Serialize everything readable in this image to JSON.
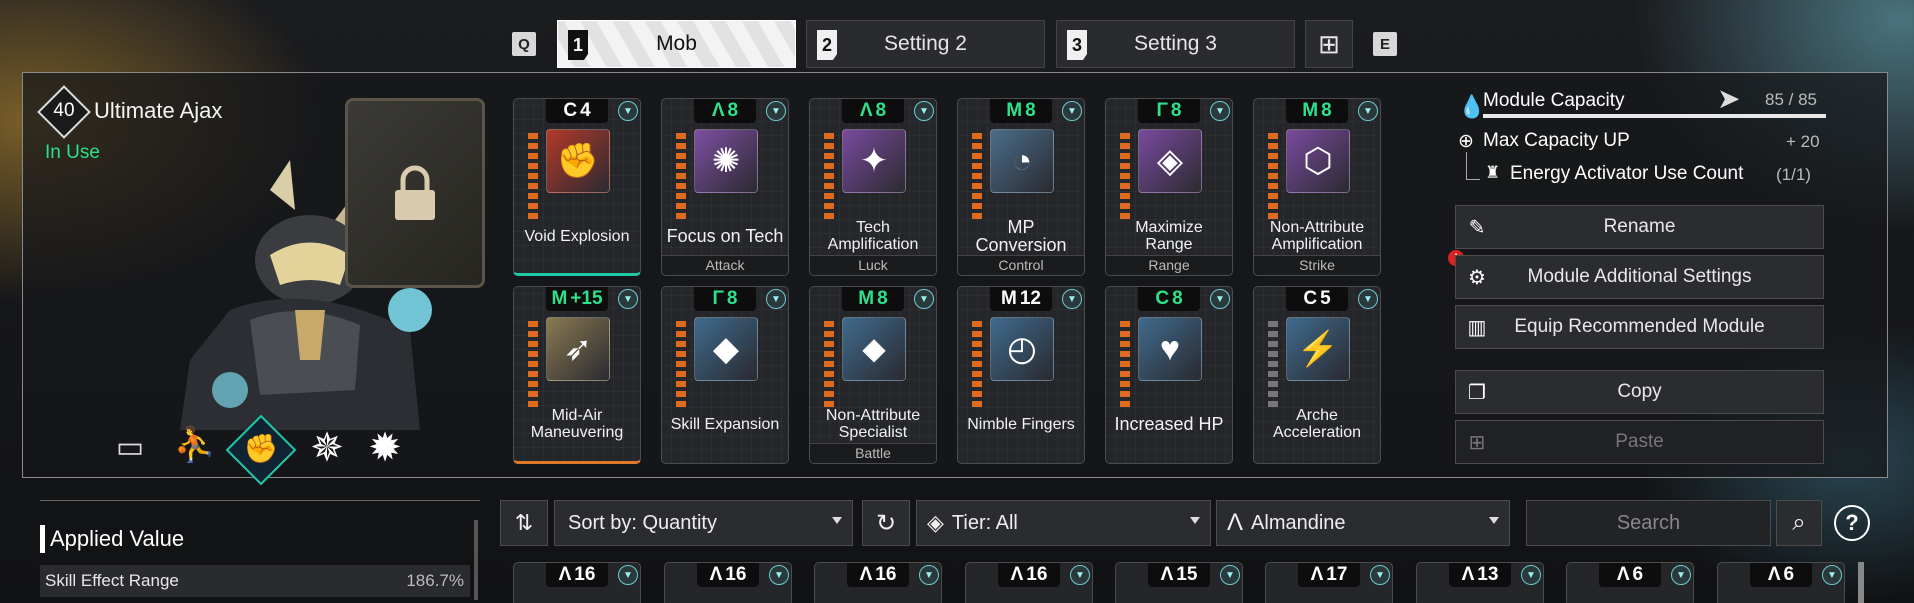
{
  "tabs": {
    "prev_key": "Q",
    "next_key": "E",
    "items": [
      {
        "num": "1",
        "label": "Mob",
        "active": true
      },
      {
        "num": "2",
        "label": "Setting 2",
        "active": false
      },
      {
        "num": "3",
        "label": "Setting 3",
        "active": false
      }
    ],
    "add_icon": "add-preset-icon"
  },
  "character": {
    "level": "40",
    "name": "Ultimate Ajax",
    "status": "In Use",
    "status_color": "#2fe08a",
    "locked_slot_icon": "lock-icon",
    "sub_icons": [
      "tank-icon",
      "jump-icon",
      "fist-icon",
      "pattern-icon",
      "burst-icon"
    ]
  },
  "modules_row1": [
    {
      "cost_icon": "C",
      "cost": "4",
      "cost_green": false,
      "name": "Void Explosion",
      "type": "",
      "icon_bg": "#b3392a",
      "icon": "fist-icon",
      "glyph": "✊",
      "bars": "orange",
      "equip": "teal"
    },
    {
      "cost_icon": "Λ",
      "cost": "8",
      "cost_green": true,
      "name": "Focus on Tech",
      "type": "Attack",
      "icon_bg": "#7e4fa3",
      "icon": "diamond-icon",
      "glyph": "✺",
      "bars": "orange"
    },
    {
      "cost_icon": "Λ",
      "cost": "8",
      "cost_green": true,
      "name": "Tech Amplification",
      "type": "Luck",
      "icon_bg": "#7a4a9e",
      "icon": "amplify-icon",
      "glyph": "✦",
      "bars": "orange"
    },
    {
      "cost_icon": "M",
      "cost": "8",
      "cost_green": true,
      "name": "MP Conversion",
      "type": "Control",
      "icon_bg": "#4a6d8a",
      "icon": "gauge-icon",
      "glyph": "◔",
      "bars": "orange"
    },
    {
      "cost_icon": "Γ",
      "cost": "8",
      "cost_green": true,
      "name": "Maximize Range",
      "type": "Range",
      "icon_bg": "#7a4a9e",
      "icon": "range-icon",
      "glyph": "◈",
      "bars": "orange"
    },
    {
      "cost_icon": "M",
      "cost": "8",
      "cost_green": true,
      "name": "Non-Attribute Amplification",
      "type": "Strike",
      "icon_bg": "#7a4a9e",
      "icon": "cube-icon",
      "glyph": "⬡",
      "bars": "orange"
    }
  ],
  "modules_row2": [
    {
      "cost_icon": "M",
      "cost": "+15",
      "cost_green": true,
      "name": "Mid-Air Maneuvering",
      "type": "",
      "icon_bg": "#8a7a52",
      "icon": "grapple-icon",
      "glyph": "➶",
      "bars": "orange",
      "equip": "orange"
    },
    {
      "cost_icon": "Γ",
      "cost": "8",
      "cost_green": true,
      "name": "Skill Expansion",
      "type": "",
      "icon_bg": "#3f6a8c",
      "icon": "expansion-icon",
      "glyph": "◆",
      "bars": "orange"
    },
    {
      "cost_icon": "M",
      "cost": "8",
      "cost_green": true,
      "name": "Non-Attribute Specialist",
      "type": "Battle",
      "icon_bg": "#3f6a8c",
      "icon": "specialist-icon",
      "glyph": "⬥",
      "bars": "orange"
    },
    {
      "cost_icon": "M",
      "cost": "12",
      "cost_green": false,
      "name": "Nimble Fingers",
      "type": "",
      "icon_bg": "#3f6a8c",
      "icon": "speed-gauge-icon",
      "glyph": "◴",
      "bars": "orange"
    },
    {
      "cost_icon": "C",
      "cost": "8",
      "cost_green": true,
      "name": "Increased HP",
      "type": "",
      "icon_bg": "#3f6a8c",
      "icon": "heart-hands-icon",
      "glyph": "♥",
      "bars": "orange"
    },
    {
      "cost_icon": "C",
      "cost": "5",
      "cost_green": false,
      "name": "Arche Acceleration",
      "type": "",
      "icon_bg": "#3f6a8c",
      "icon": "acceleration-icon",
      "glyph": "⚡",
      "bars": "grey"
    }
  ],
  "capacity": {
    "label": "Module Capacity",
    "value": "85 / 85",
    "fill": 1.0,
    "max_up_label": "Max Capacity UP",
    "max_up_value": "+ 20",
    "energy_label": "Energy Activator Use Count",
    "energy_value": "(1/1)"
  },
  "buttons": {
    "rename": "Rename",
    "additional": "Module Additional Settings",
    "recommended": "Equip Recommended Module",
    "copy": "Copy",
    "paste": "Paste"
  },
  "applied": {
    "title": "Applied Value",
    "rows": [
      {
        "label": "Skill Effect Range",
        "value": "186.7%"
      }
    ]
  },
  "filters": {
    "sort": "Sort by: Quantity",
    "tier": "Tier: All",
    "socket": "Almandine",
    "search_placeholder": "Search",
    "help": "?"
  },
  "inventory": [
    {
      "cost": "16"
    },
    {
      "cost": "16"
    },
    {
      "cost": "16"
    },
    {
      "cost": "16"
    },
    {
      "cost": "15"
    },
    {
      "cost": "17"
    },
    {
      "cost": "13"
    },
    {
      "cost": "6"
    },
    {
      "cost": "6"
    }
  ]
}
